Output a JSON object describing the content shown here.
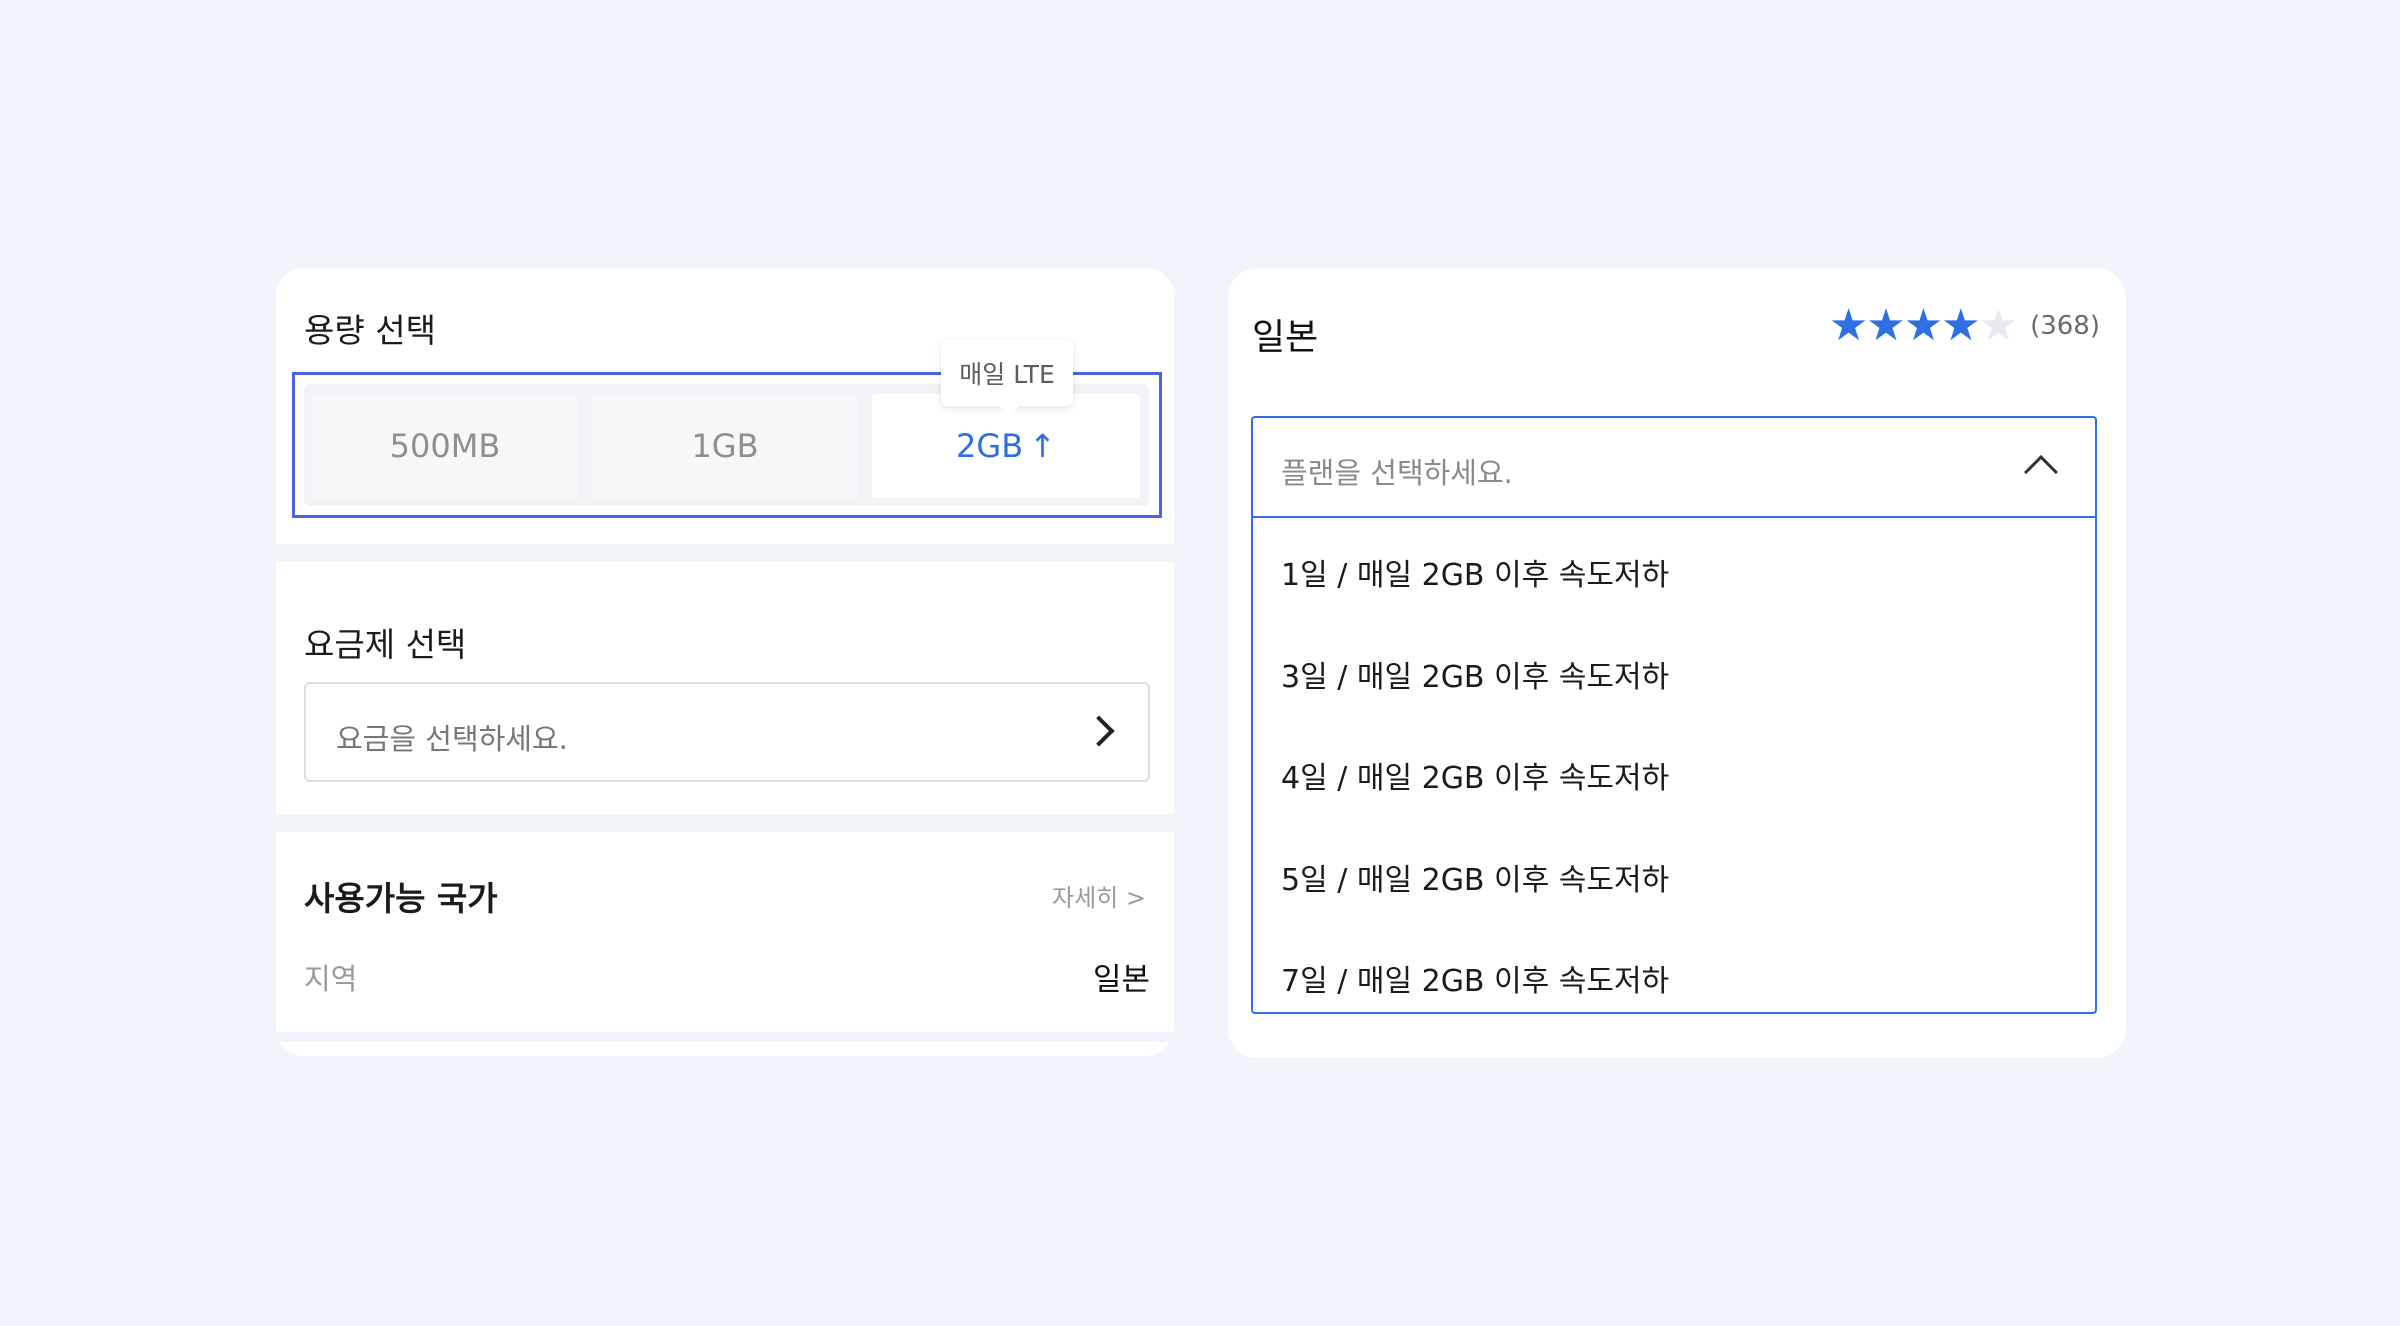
{
  "capacity": {
    "title": "용량 선택",
    "options": [
      "500MB",
      "1GB",
      "2GB"
    ],
    "selected_arrow": "↑",
    "tooltip": "매일 LTE"
  },
  "plan": {
    "title": "요금제 선택",
    "placeholder": "요금을 선택하세요."
  },
  "countries": {
    "title": "사용가능 국가",
    "more_label": "자세히 >",
    "region_label": "지역",
    "region_value": "일본"
  },
  "product": {
    "country": "일본",
    "rating": 4,
    "rating_max": 5,
    "review_count": "(368)"
  },
  "plan_dropdown": {
    "placeholder": "플랜을 선택하세요.",
    "options": [
      "1일 / 매일 2GB 이후 속도저하",
      "3일 / 매일 2GB 이후 속도저하",
      "4일 / 매일 2GB 이후 속도저하",
      "5일 / 매일 2GB 이후 속도저하",
      "7일 / 매일 2GB 이후 속도저하"
    ]
  },
  "colors": {
    "accent": "#2f6fe4",
    "highlight_border": "#4a63e0",
    "background": "#f0f5fc"
  }
}
